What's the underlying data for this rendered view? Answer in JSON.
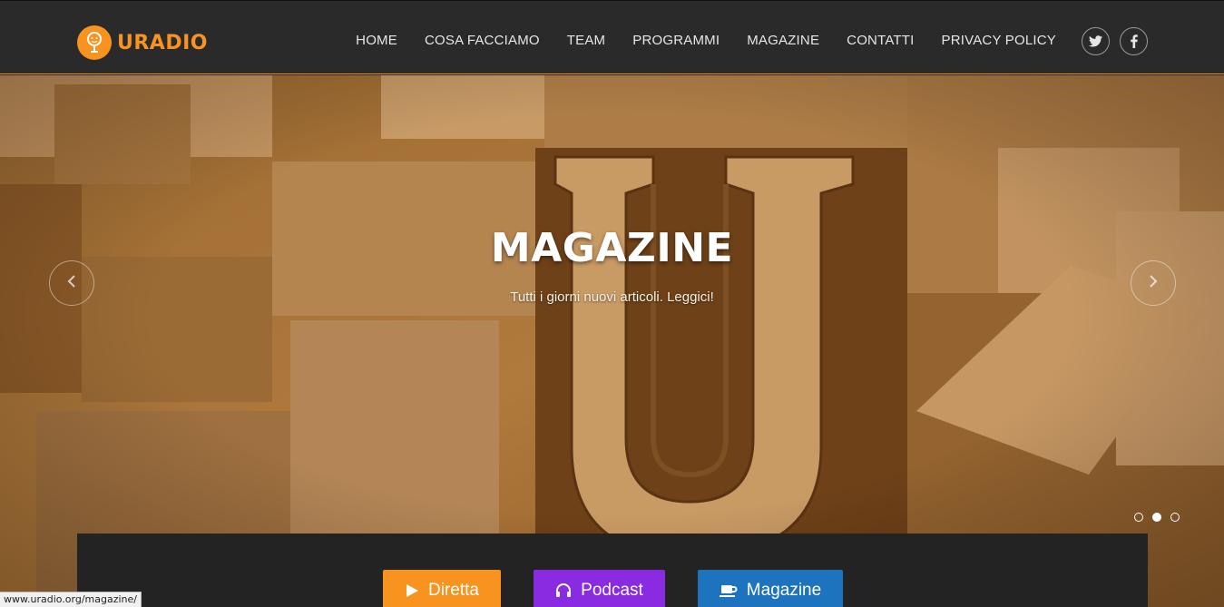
{
  "brand": {
    "name": "URADIO",
    "accent": "#f7931e"
  },
  "nav": {
    "items": [
      {
        "label": "HOME"
      },
      {
        "label": "COSA FACCIAMO"
      },
      {
        "label": "TEAM"
      },
      {
        "label": "PROGRAMMI"
      },
      {
        "label": "MAGAZINE"
      },
      {
        "label": "CONTATTI"
      },
      {
        "label": "PRIVACY POLICY"
      }
    ],
    "social": [
      {
        "icon": "twitter-icon"
      },
      {
        "icon": "facebook-icon"
      }
    ]
  },
  "hero": {
    "title": "MAGAZINE",
    "subtitle": "Tutti i giorni nuovi articoli. Leggici!",
    "slides": 3,
    "active_slide": 2
  },
  "cta": {
    "diretta": {
      "label": "Diretta",
      "color": "#f7931e"
    },
    "podcast": {
      "label": "Podcast",
      "color": "#8a2be2"
    },
    "magazine": {
      "label": "Magazine",
      "color": "#1e73be"
    }
  },
  "status_bar": {
    "url": "www.uradio.org/magazine/"
  }
}
